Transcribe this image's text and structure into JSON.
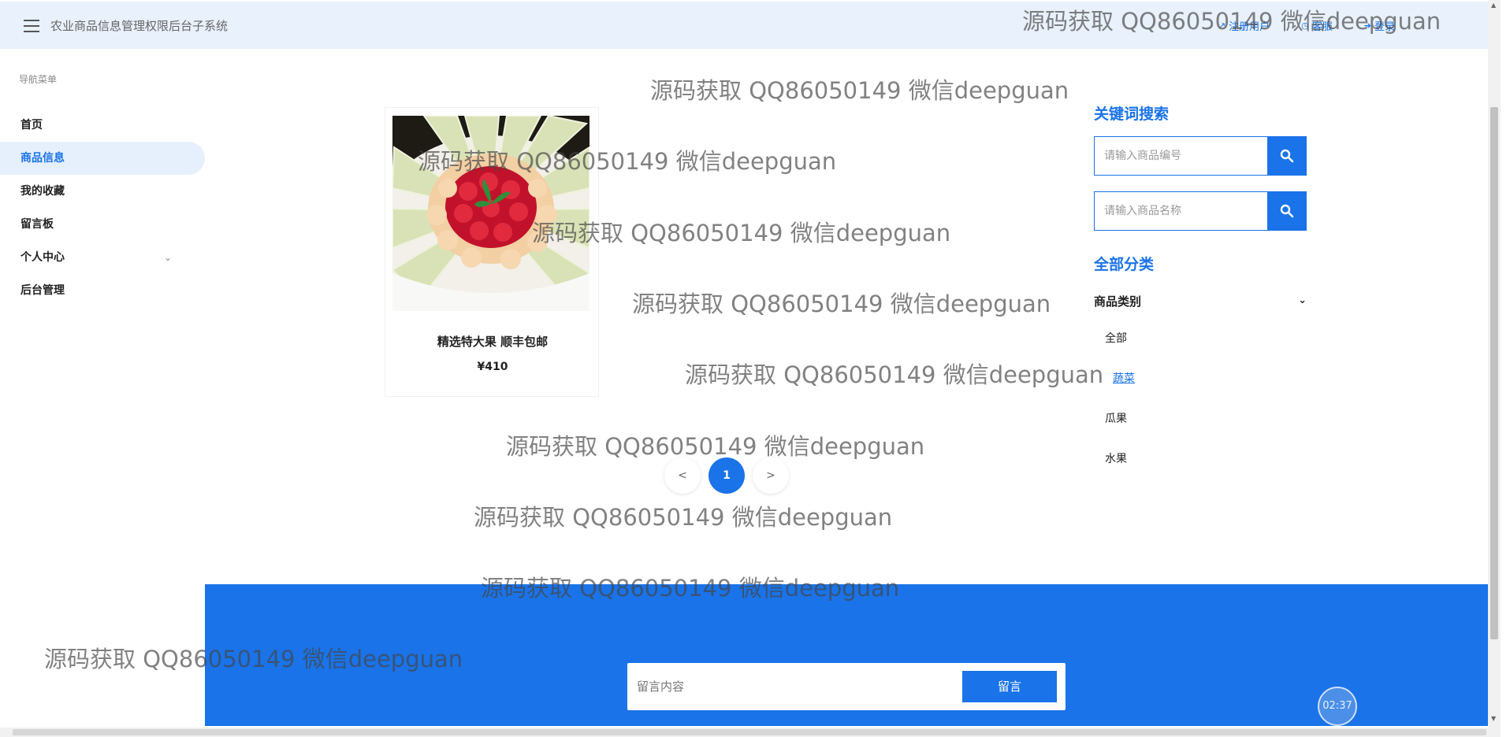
{
  "header": {
    "app_title": "农业商品信息管理权限后台子系统",
    "links": [
      {
        "icon": "register-icon",
        "label": "注册用户"
      },
      {
        "icon": "service-icon",
        "label": "客服"
      },
      {
        "icon": "login-icon",
        "label": "登录"
      }
    ]
  },
  "sidebar": {
    "caption": "导航菜单",
    "items": [
      {
        "label": "首页"
      },
      {
        "label": "商品信息",
        "active": true
      },
      {
        "label": "我的收藏"
      },
      {
        "label": "留言板"
      },
      {
        "label": "个人中心",
        "has_submenu": true
      },
      {
        "label": "后台管理"
      }
    ]
  },
  "product": {
    "name": "精选特大果 顺丰包邮",
    "price": "¥410"
  },
  "pagination": {
    "prev": "<",
    "current": "1",
    "next": ">"
  },
  "search": {
    "title": "关键词搜索",
    "code_placeholder": "请输入商品编号",
    "name_placeholder": "请输入商品名称"
  },
  "categories": {
    "title": "全部分类",
    "dropdown_label": "商品类别",
    "items": [
      "全部",
      "蔬菜",
      "瓜果",
      "水果"
    ]
  },
  "message": {
    "placeholder": "留言内容",
    "button_label": "留言"
  },
  "clock": "02:37",
  "watermark": "源码获取 QQ86050149 微信deepguan",
  "colors": {
    "accent": "#1a73e8",
    "header_bg": "#e8f1fc",
    "sidebar_active_bg": "#e6f0fd"
  }
}
